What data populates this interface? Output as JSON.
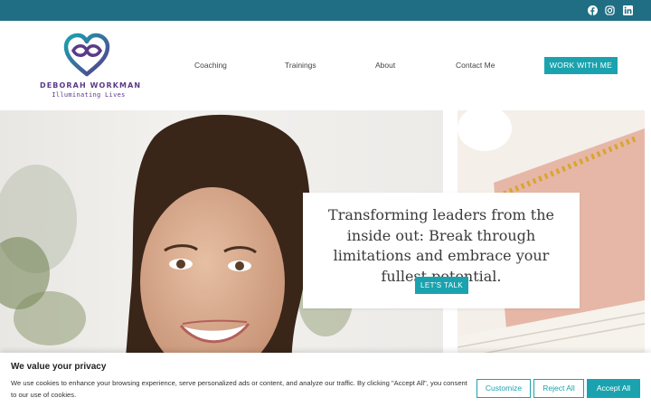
{
  "topbar": {
    "social": [
      {
        "name": "facebook-icon"
      },
      {
        "name": "instagram-icon"
      },
      {
        "name": "linkedin-icon"
      }
    ]
  },
  "logo": {
    "name": "DEBORAH WORKMAN",
    "tagline": "Illuminating Lives",
    "colors": {
      "primary": "#5a3a8a",
      "accent": "#1aa3ae"
    }
  },
  "nav": {
    "items": [
      "Coaching",
      "Trainings",
      "About",
      "Contact Me"
    ],
    "cta": "WORK WITH ME"
  },
  "hero": {
    "heading": "Transforming leaders from the inside out: Break through limitations and embrace your fullest potential.",
    "button": "LET'S TALK"
  },
  "cookie": {
    "title": "We value your privacy",
    "text": "We use cookies to enhance your browsing experience, serve personalized ads or content, and analyze our traffic. By clicking \"Accept All\", you consent to our use of cookies.",
    "customize": "Customize",
    "reject": "Reject All",
    "accept": "Accept All"
  },
  "colors": {
    "topbar": "#1f6e84",
    "button": "#1aa3ae"
  }
}
